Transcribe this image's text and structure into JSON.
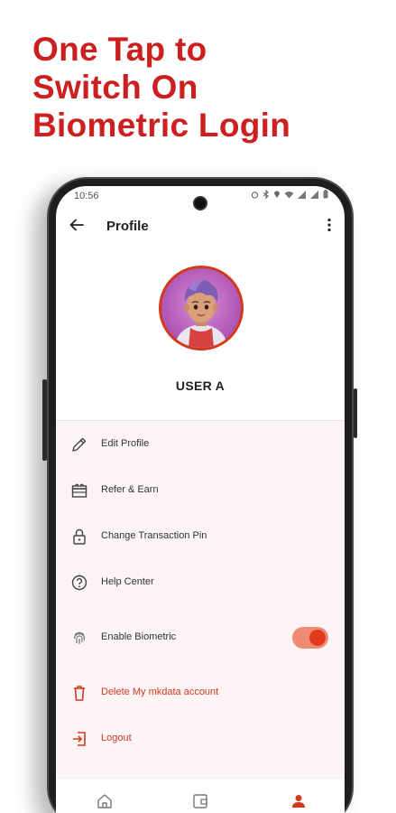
{
  "headline": {
    "lines": [
      "One Tap to",
      "Switch On",
      "Biometric Login"
    ]
  },
  "status_bar": {
    "time": "10:56"
  },
  "app_bar": {
    "title": "Profile"
  },
  "profile": {
    "username": "USER A"
  },
  "menu": {
    "items": [
      {
        "label": "Edit Profile",
        "icon": "pencil-icon"
      },
      {
        "label": "Refer & Earn",
        "icon": "gift-icon"
      },
      {
        "label": "Change Transaction Pin",
        "icon": "lock-icon"
      },
      {
        "label": "Help Center",
        "icon": "help-circle-icon"
      },
      {
        "label": "Enable Biometric",
        "icon": "fingerprint-icon",
        "toggle_on": true
      },
      {
        "label": "Delete My mkdata account",
        "icon": "trash-icon",
        "danger": true
      },
      {
        "label": "Logout",
        "icon": "logout-icon",
        "danger": true
      }
    ]
  },
  "bottom_nav": {
    "items": [
      {
        "icon": "home-icon",
        "active": false
      },
      {
        "icon": "wallet-icon",
        "active": false
      },
      {
        "icon": "profile-icon",
        "active": true
      }
    ]
  },
  "colors": {
    "brand": "#cc1f1f",
    "accent": "#e33a1c",
    "menu_background": "#fdf4f6"
  }
}
